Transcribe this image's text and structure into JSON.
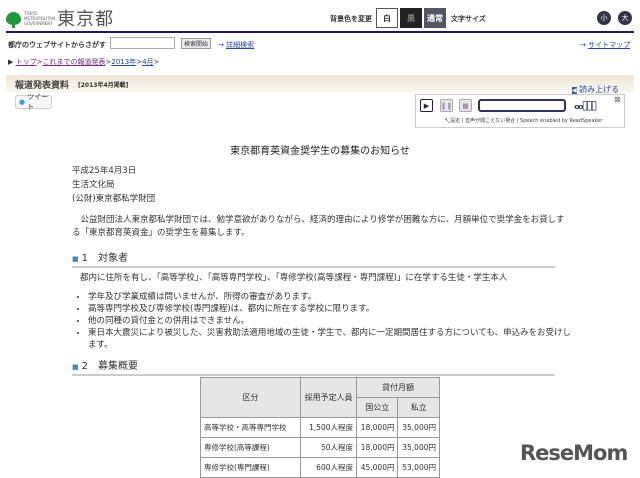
{
  "header": {
    "logo_en": "TOKYO METROPOLITAN GOVERNMENT",
    "logo_jp": "東京都",
    "bg_label": "背景色を変更",
    "bg_white": "白",
    "bg_black": "黒",
    "bg_normal": "通常",
    "font_label": "文字サイズ",
    "font_small": "小",
    "font_large": "大"
  },
  "search": {
    "label": "都庁のウェブサイトからさがす",
    "value": "",
    "button": "検索開始",
    "advanced": "詳細検索",
    "sitemap": "サイトマップ"
  },
  "breadcrumb": [
    "トップ",
    "これまでの報道発表",
    "2013年",
    "4月"
  ],
  "band": {
    "title": "報道発表資料",
    "date": "[2013年4月掲載]"
  },
  "tweet": "ツイート",
  "readspeaker": {
    "read": "読み上げる",
    "settings": "設定",
    "help": "音声が聞こえない場合",
    "credit": "Speech enabled by ReadSpeaker"
  },
  "article": {
    "title": "東京都育英資金奨学生の募集のお知らせ",
    "date": "平成25年4月3日",
    "org1": "生活文化局",
    "org2": "(公財)東京都私学財団",
    "intro": "　公益財団法人東京都私学財団では、勉学意欲がありながら、経済的理由により修学が困難な方に、月額単位で奨学金をお貸しする「東京都育英資金」の奨学生を募集します。",
    "sec1": "1　対象者",
    "sec1_text": "都内に住所を有し、「高等学校」、「高等専門学校」、「専修学校(高等課程・専門課程)」に在学する生徒・学生本人",
    "bullets": [
      "学年及び学業成績は問いませんが、所得の審査があります。",
      "高等専門学校及び専修学校(専門課程)は、都内に所在する学校に限ります。",
      "他の同種の貸付金との併用はできません。",
      "東日本大震災により被災した、災害救助法適用地域の生徒・学生で、都内に一定期間居住する方についても、申込みをお受けします。"
    ],
    "sec2": "2　募集概要"
  },
  "table": {
    "h_category": "区分",
    "h_people": "採用予定人員",
    "h_amount": "貸付月額",
    "h_public": "国公立",
    "h_private": "私立",
    "rows": [
      [
        "高等学校・高等専門学校",
        "1,500人程度",
        "18,000円",
        "35,000円"
      ],
      [
        "専修学校(高等課程)",
        "50人程度",
        "18,000円",
        "35,000円"
      ],
      [
        "専修学校(専門課程)",
        "600人程度",
        "45,000円",
        "53,000円"
      ]
    ]
  },
  "watermark": "ReseMom"
}
